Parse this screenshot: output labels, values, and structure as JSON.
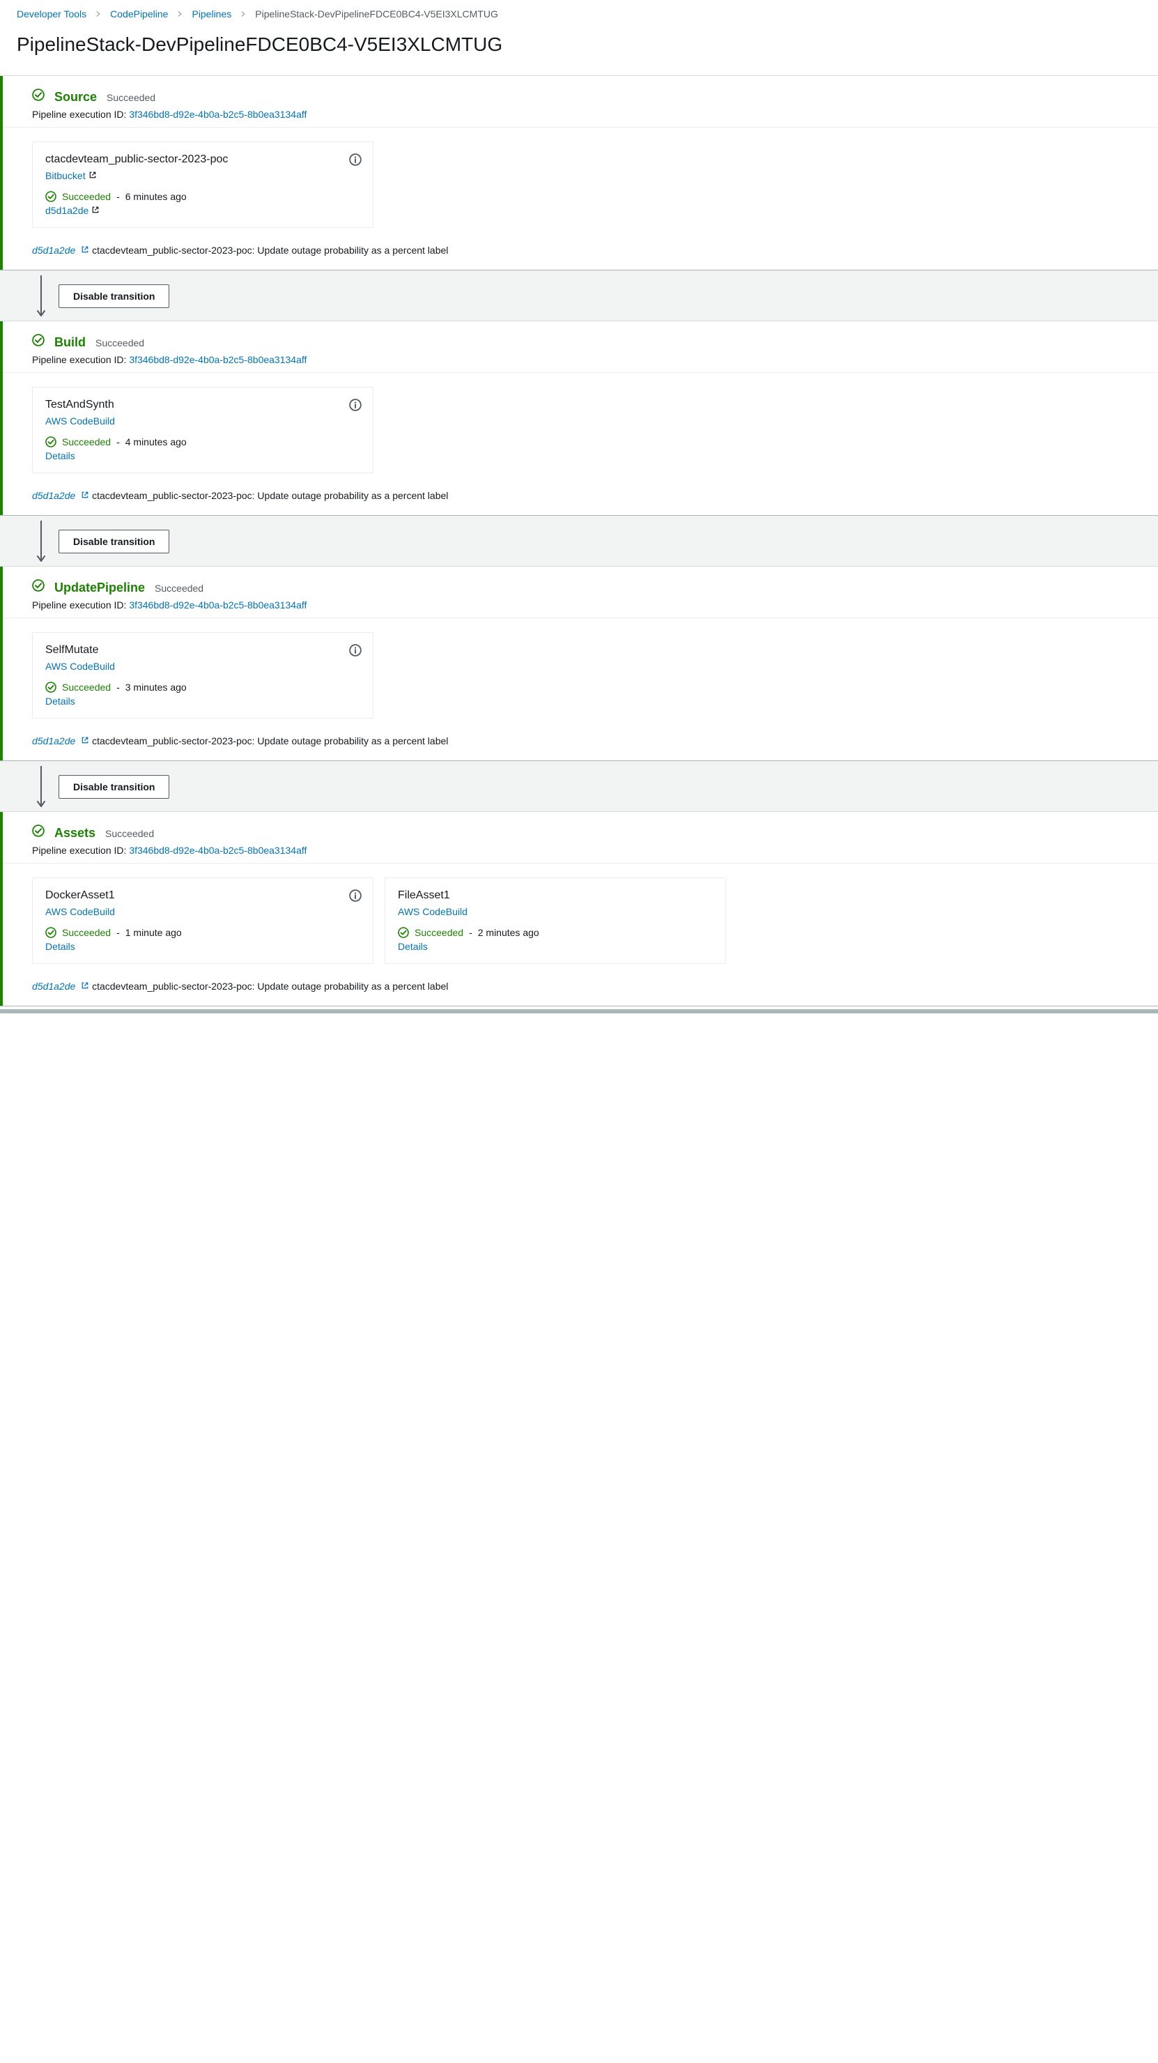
{
  "breadcrumbs": {
    "items": [
      {
        "label": "Developer Tools"
      },
      {
        "label": "CodePipeline"
      },
      {
        "label": "Pipelines"
      }
    ],
    "current": "PipelineStack-DevPipelineFDCE0BC4-V5EI3XLCMTUG"
  },
  "title": "PipelineStack-DevPipelineFDCE0BC4-V5EI3XLCMTUG",
  "exec_label": "Pipeline execution ID:",
  "exec_id": "3f346bd8-d92e-4b0a-b2c5-8b0ea3134aff",
  "commit_short": "d5d1a2de",
  "commit_msg": "ctacdevteam_public-sector-2023-poc: Update outage probability as a percent label",
  "transition_label": "Disable transition",
  "stages": [
    {
      "name": "Source",
      "status": "Succeeded",
      "actions": [
        {
          "name": "ctacdevteam_public-sector-2023-poc",
          "provider": "Bitbucket",
          "provider_ext": true,
          "status": "Succeeded",
          "time": "6 minutes ago",
          "detail_link": "d5d1a2de",
          "detail_ext": true
        }
      ]
    },
    {
      "name": "Build",
      "status": "Succeeded",
      "actions": [
        {
          "name": "TestAndSynth",
          "provider": "AWS CodeBuild",
          "provider_ext": false,
          "status": "Succeeded",
          "time": "4 minutes ago",
          "detail_link": "Details",
          "detail_ext": false
        }
      ]
    },
    {
      "name": "UpdatePipeline",
      "status": "Succeeded",
      "actions": [
        {
          "name": "SelfMutate",
          "provider": "AWS CodeBuild",
          "provider_ext": false,
          "status": "Succeeded",
          "time": "3 minutes ago",
          "detail_link": "Details",
          "detail_ext": false
        }
      ]
    },
    {
      "name": "Assets",
      "status": "Succeeded",
      "actions": [
        {
          "name": "DockerAsset1",
          "provider": "AWS CodeBuild",
          "provider_ext": false,
          "status": "Succeeded",
          "time": "1 minute ago",
          "detail_link": "Details",
          "detail_ext": false
        },
        {
          "name": "FileAsset1",
          "provider": "AWS CodeBuild",
          "provider_ext": false,
          "status": "Succeeded",
          "time": "2 minutes ago",
          "detail_link": "Details",
          "detail_ext": false
        }
      ]
    }
  ]
}
